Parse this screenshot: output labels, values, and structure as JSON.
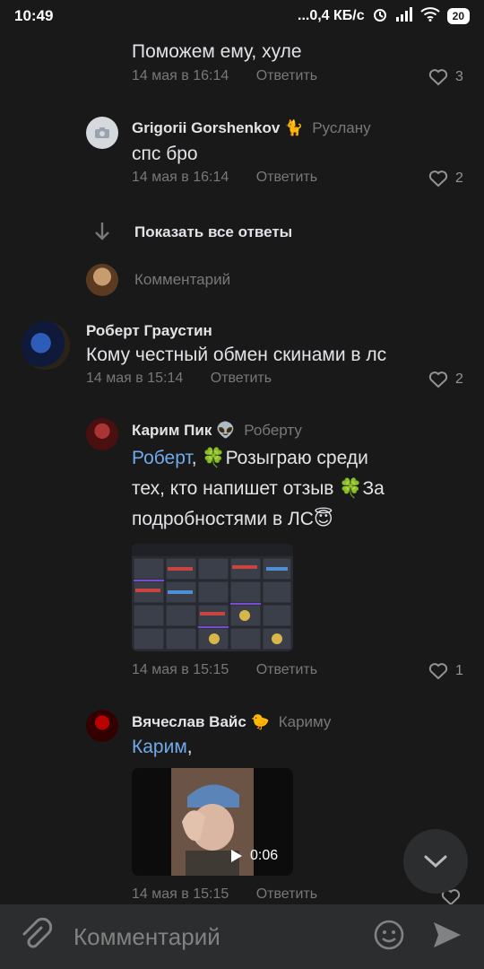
{
  "status": {
    "time": "10:49",
    "net": "...0,4 КБ/с",
    "battery": "20"
  },
  "comments": [
    {
      "text": "Поможем ему, хуле",
      "date": "14 мая в 16:14",
      "reply": "Ответить",
      "likes": "3"
    },
    {
      "name": "Grigorii Gorshenkov 🐈",
      "reply_to": "Руслану",
      "text": "спс бро",
      "date": "14 мая в 16:14",
      "reply": "Ответить",
      "likes": "2"
    }
  ],
  "show_all": "Показать все ответы",
  "comment_placeholder_inline": "Комментарий",
  "root_comment": {
    "name": "Роберт Граустин",
    "text": "Кому честный обмен скинами в лс",
    "date": "14 мая в 15:14",
    "reply": "Ответить",
    "likes": "2"
  },
  "reply1": {
    "name": "Карим Пик 👽",
    "reply_to": "Роберту",
    "mention": "Роберт",
    "line1_rest": ", 🍀Розыграю среди",
    "line2": "тех, кто напишет отзыв 🍀За",
    "line3": "подробностями в ЛС😇",
    "date": "14 мая в 15:15",
    "reply": "Ответить",
    "likes": "1"
  },
  "reply2": {
    "name": "Вячеслав Вайс 🐤",
    "reply_to": "Кариму",
    "mention": "Карим",
    "mention_rest": ",",
    "video_duration": "0:06",
    "date": "14 мая в 15:15",
    "reply": "Ответить"
  },
  "composer": {
    "placeholder": "Комментарий"
  },
  "colors": {
    "bg": "#19191a",
    "accent": "#71aaeb",
    "muted": "#76787a"
  }
}
